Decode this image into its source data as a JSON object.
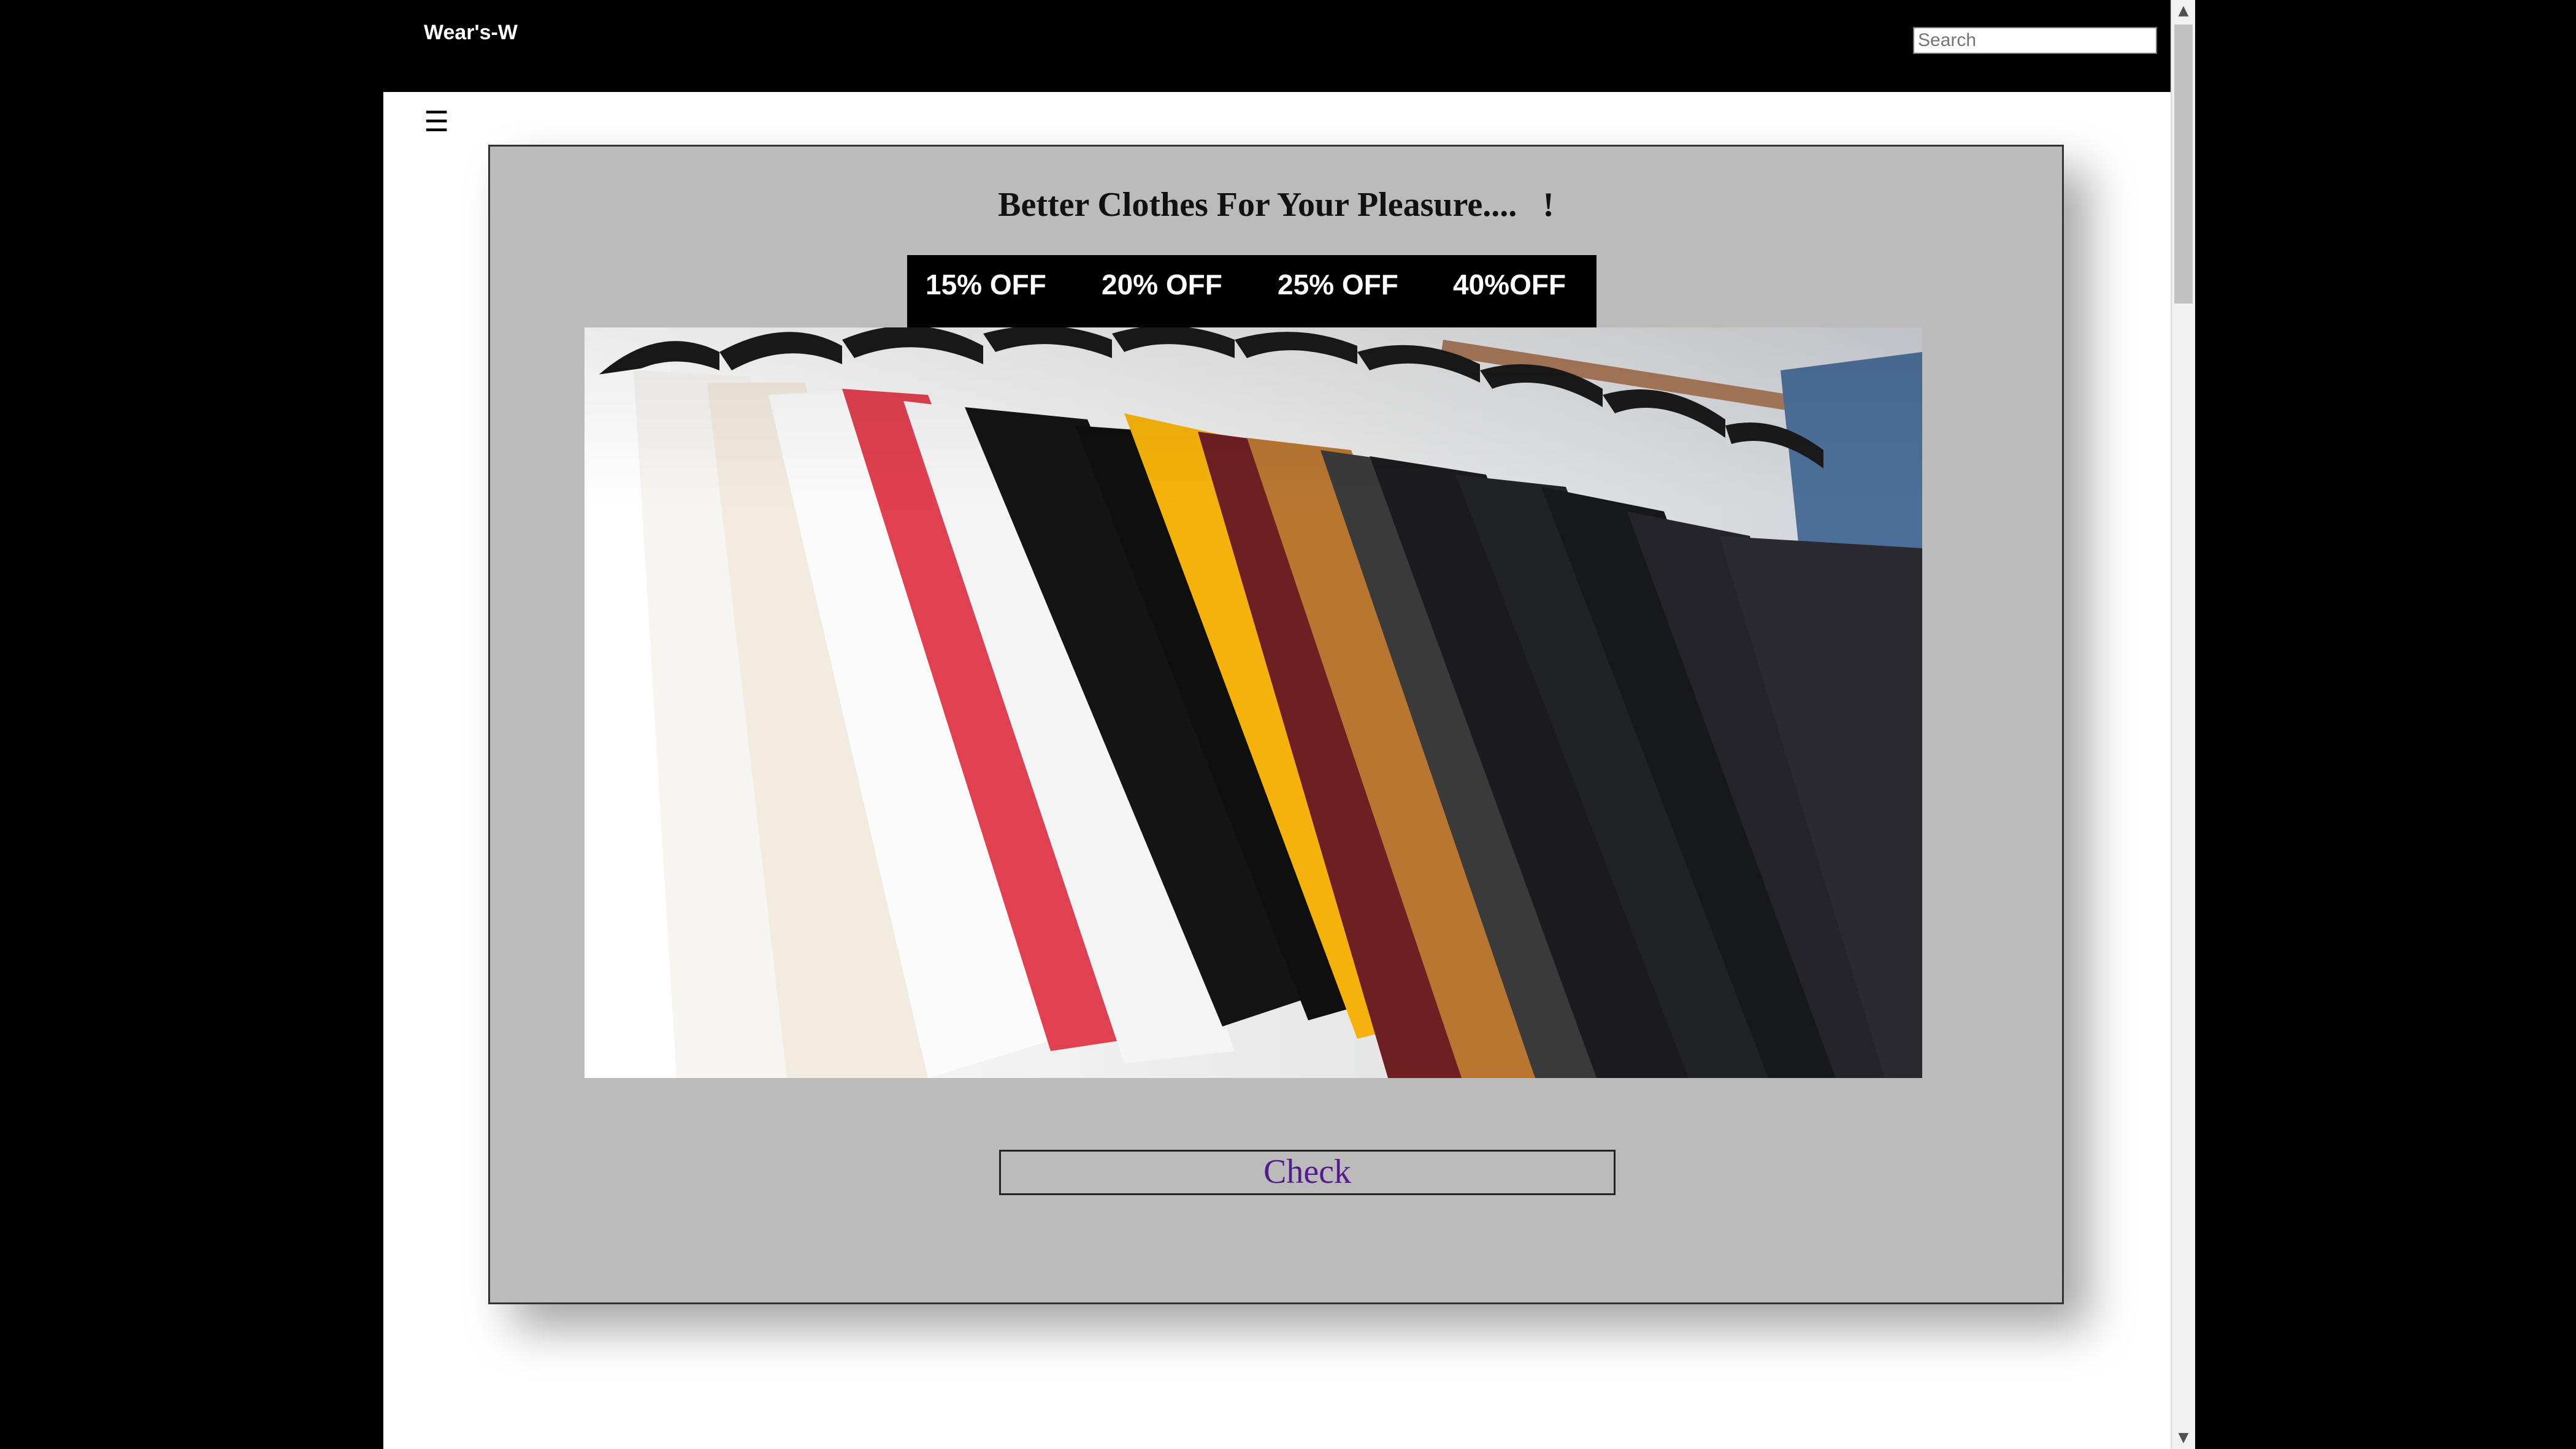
{
  "header": {
    "brand": "Wear's-W",
    "search_placeholder": "Search"
  },
  "menu": {
    "icon": "hamburger-menu-icon",
    "glyph": "☰"
  },
  "card": {
    "headline": "Better Clothes For Your Pleasure....   !",
    "offers": [
      "15% OFF",
      "20% OFF",
      "25% OFF",
      "40%OFF"
    ],
    "hero_image": "clothing-rack-tshirts",
    "check_label": "Check"
  },
  "scrollbar": {
    "up": "▲",
    "down": "▼",
    "position": 0
  },
  "colors": {
    "page_bg": "#000000",
    "content_bg": "#ffffff",
    "card_bg": "#bbbbbb",
    "link_purple": "#551a8b"
  }
}
